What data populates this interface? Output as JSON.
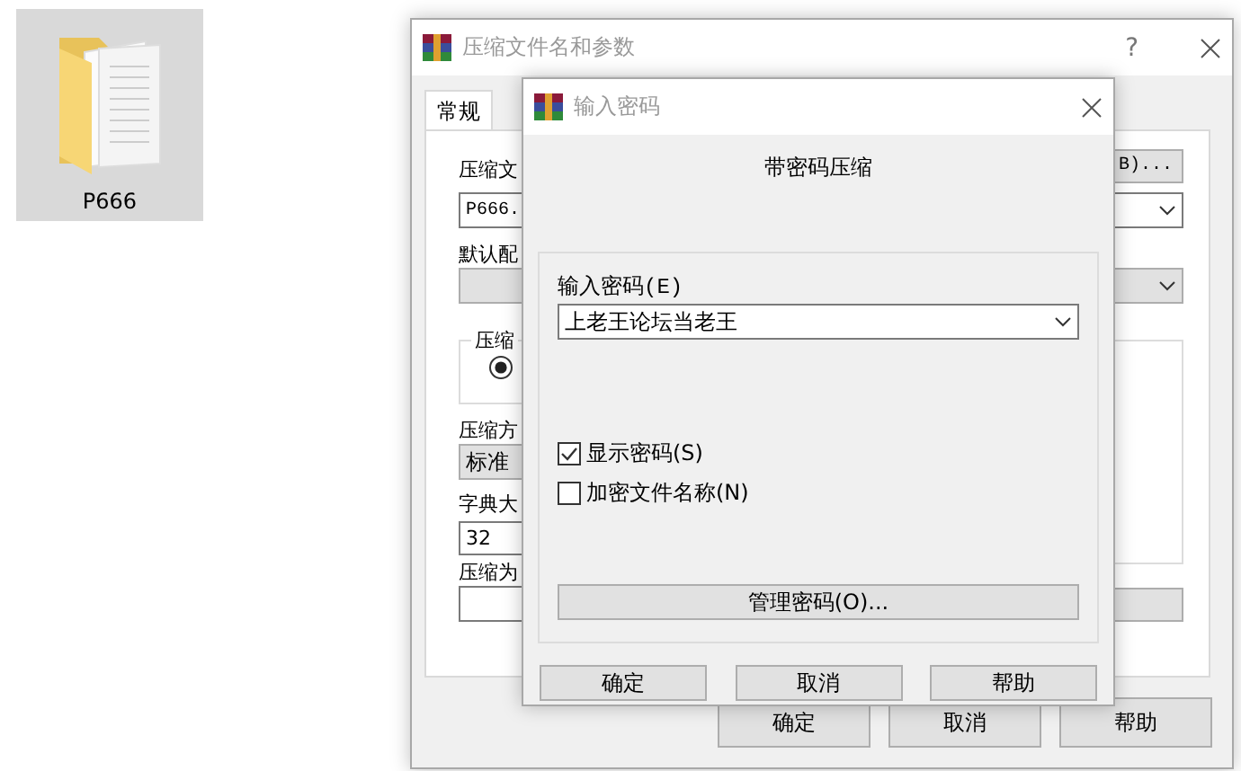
{
  "desktop_icon": {
    "label": "P666",
    "selected": true
  },
  "archive_dialog": {
    "title": "压缩文件名和参数",
    "help_button": "?",
    "tabs": [
      {
        "label": "常规",
        "selected": true
      }
    ],
    "archive_name_label": "压缩文",
    "browse_button": "B)...",
    "archive_name": "P666.",
    "profile_label": "默认配",
    "group_label": "压缩",
    "format_radio": {
      "checked": true
    },
    "method_label": "压缩方",
    "method_value": "标准",
    "dictionary_label": "字典大",
    "dictionary_value": "32",
    "split_label": "压缩为",
    "buttons": [
      "确定",
      "取消",
      "帮助"
    ]
  },
  "password_dialog": {
    "title": "输入密码",
    "heading": "带密码压缩",
    "password_label": "输入密码(E)",
    "password_value": "上老王论坛当老王",
    "options": [
      {
        "label": "显示密码(S)",
        "checked": true
      },
      {
        "label": "加密文件名称(N)",
        "checked": false
      }
    ],
    "manage_button": "管理密码(O)...",
    "buttons": [
      "确定",
      "取消",
      "帮助"
    ]
  }
}
